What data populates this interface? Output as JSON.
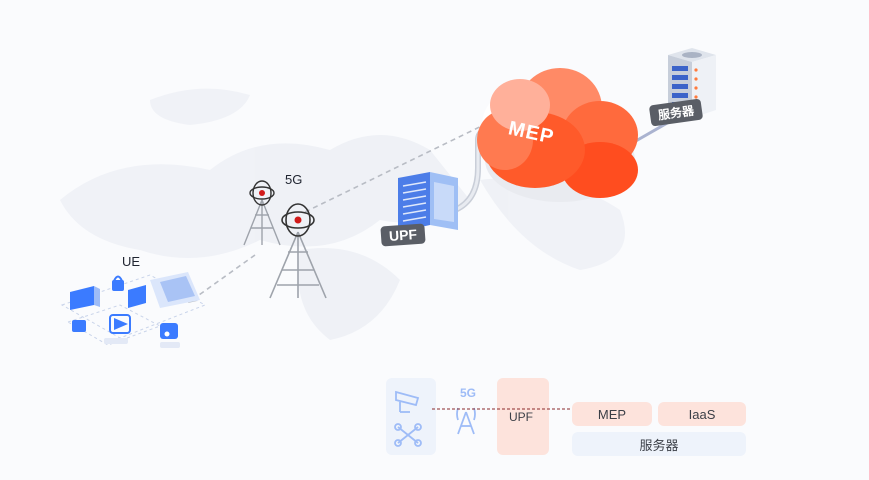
{
  "diagram": {
    "ue_label": "UE",
    "fiveg_label": "5G",
    "upf_label": "UPF",
    "mep_label": "MEP",
    "server_label": "服务器"
  },
  "legend": {
    "fiveg": "5G",
    "upf": "UPF",
    "mep": "MEP",
    "iaas": "IaaS",
    "server": "服务器"
  },
  "colors": {
    "cloud_primary": "#ff5a2a",
    "cloud_light": "#ff9a7a",
    "link_dashed": "#b8bcc4",
    "device_blue": "#3b7bff",
    "legend_red": "#fde3dc",
    "legend_blue": "#eef3fb"
  }
}
